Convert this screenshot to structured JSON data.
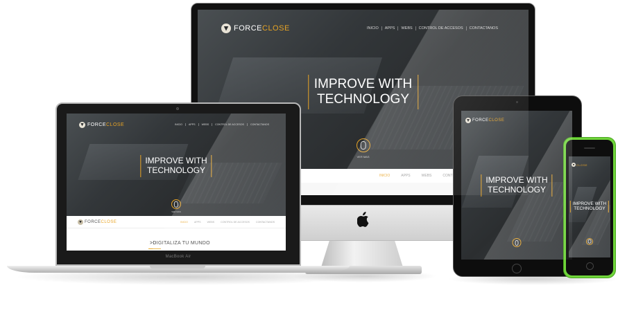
{
  "brand": {
    "force": "FORCE",
    "close": "CLOSE",
    "accent_color": "#e8a425"
  },
  "menu": [
    "INICIO",
    "APPS",
    "WEBS",
    "CONTROL DE ACCESOS",
    "CONTACTANOS"
  ],
  "subnav": [
    "INICIO",
    "APPS",
    "WEBS",
    "CONTROL DE ACCESOS",
    "CONTACTANOS"
  ],
  "imac_subnav": [
    "INICIO",
    "APPS",
    "WEBS",
    "CONTROL D"
  ],
  "hero": {
    "title_line1": "IMPROVE WITH",
    "title_line2": "TECHNOLOGY",
    "phone_title_line1": "IMPROVE WITH",
    "phone_title_line2": "TECHNOLOGY"
  },
  "scroll_label": "VER MAS",
  "macbook": {
    "label": "MacBook Air",
    "section_heading": "DIGITALIZA TU MUNDO",
    "section_prefix": ">"
  },
  "icons": {
    "apple": "apple-logo-icon",
    "mouse": "mouse-scroll-icon",
    "logo": "forceclose-shield-icon"
  }
}
